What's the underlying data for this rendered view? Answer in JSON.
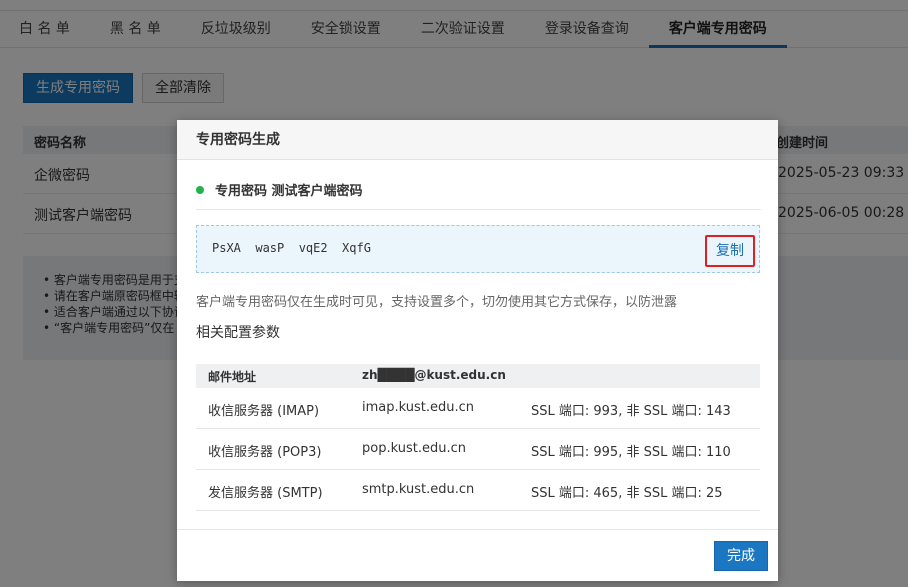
{
  "tabs": [
    "白 名 单",
    "黑 名 单",
    "反垃圾级别",
    "安全锁设置",
    "二次验证设置",
    "登录设备查询",
    "客户端专用密码"
  ],
  "toolbar": {
    "generate_label": "生成专用密码",
    "clear_label": "全部清除"
  },
  "table": {
    "col_name": "密码名称",
    "col_created": "创建时间",
    "rows": [
      {
        "name": "企微密码",
        "created": "2025-05-23 09:33"
      },
      {
        "name": "测试客户端密码",
        "created": "2025-06-05 00:28"
      }
    ]
  },
  "notes": [
    "• 客户端专用密码是用于支",
    "• 请在客户端原密码框中输",
    "• 适合客户端通过以下协议",
    "• “客户端专用密码”仅在"
  ],
  "modal": {
    "title": "专用密码生成",
    "subtitle": "专用密码 测试客户端密码",
    "password": "PsXA  wasP  vqE2  XqfG",
    "copy_label": "复制",
    "tip": "客户端专用密码仅在生成时可见，支持设置多个，切勿使用其它方式保存，以防泄露",
    "config_title": "相关配置参数",
    "config_head": {
      "label": "邮件地址",
      "value": "zh████@kust.edu.cn"
    },
    "config_rows": [
      {
        "name": "收信服务器 (IMAP)",
        "host": "imap.kust.edu.cn",
        "ports": "SSL 端口: 993, 非 SSL 端口: 143"
      },
      {
        "name": "收信服务器 (POP3)",
        "host": "pop.kust.edu.cn",
        "ports": "SSL 端口: 995, 非 SSL 端口: 110"
      },
      {
        "name": "发信服务器 (SMTP)",
        "host": "smtp.kust.edu.cn",
        "ports": "SSL 端口: 465, 非 SSL 端口: 25"
      }
    ],
    "done_label": "完成"
  },
  "colors": {
    "accent": "#1b77c1",
    "status_green": "#21b24a",
    "highlight_red": "#e02020"
  }
}
